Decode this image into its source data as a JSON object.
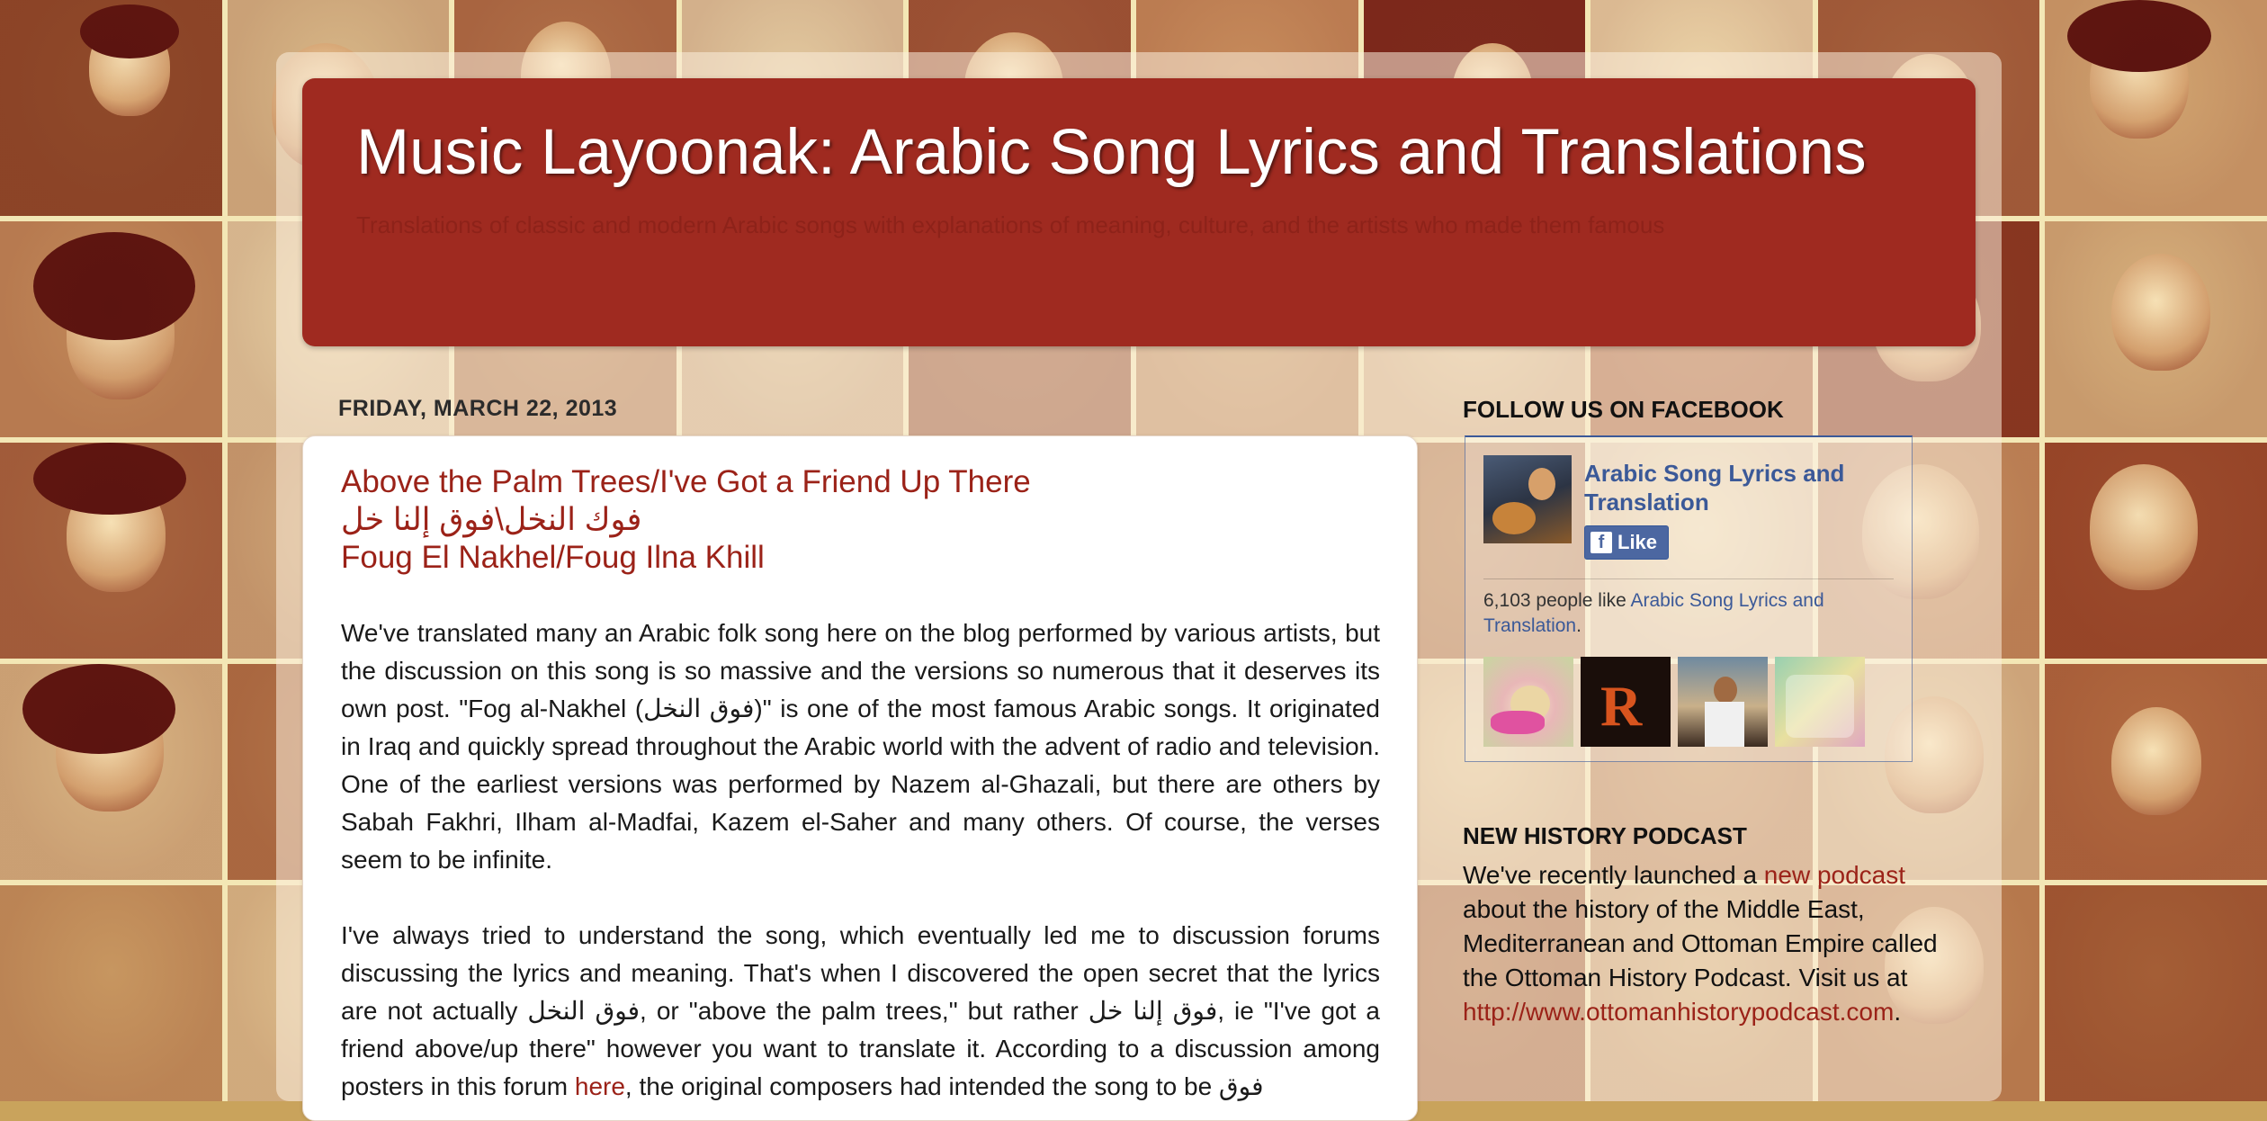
{
  "blog": {
    "title": "Music Layoonak: Arabic Song Lyrics and Translations",
    "description": "Translations of classic and modern Arabic songs with explanations of meaning, culture, and the artists who made them famous"
  },
  "post": {
    "date_header": "FRIDAY, MARCH 22, 2013",
    "title_line1": "Above the Palm Trees/I've Got a Friend Up There",
    "title_line2": "فوك النخل\\فوق إلنا خل",
    "title_line3": "Foug El Nakhel/Foug Ilna Khill",
    "p1": "We've translated many an Arabic folk song here on the blog performed by various artists, but the discussion on this song is so massive and the versions so numerous that it deserves its own post. \"Fog al-Nakhel (فوق النخل)\" is one of the most famous Arabic songs. It originated in Iraq and quickly spread throughout the Arabic world with the advent of radio and television. One of the earliest versions was performed by Nazem al-Ghazali, but there are others by Sabah Fakhri, Ilham al-Madfai, Kazem el-Saher and many others. Of course, the verses seem to be infinite.",
    "p2_before_link": "I've always tried to understand the song, which eventually led me to discussion forums discussing the lyrics and meaning. That's when I discovered the open secret that the lyrics are not actually فوق النخل, or \"above the palm trees,\" but rather فوق إلنا خل, ie \"I've got a friend above/up there\" however you want to translate it. According to a discussion among posters in this forum ",
    "p2_link": "here",
    "p2_after_link": ", the original composers had intended the song to be فوق"
  },
  "sidebar": {
    "facebook": {
      "heading": "FOLLOW US ON FACEBOOK",
      "page_name": "Arabic Song Lyrics and Translation",
      "like_label": "Like",
      "like_icon": "f",
      "count_prefix": "6,103 people like ",
      "count_link": "Arabic Song Lyrics and Translation",
      "count_suffix": "."
    },
    "podcast": {
      "heading": "NEW HISTORY PODCAST",
      "text_before_link": "We've recently launched a ",
      "link": "new podcast",
      "text_after_link": " about the history of the Middle East, Mediterranean and Ottoman Empire called the Ottoman History Podcast. Visit us at ",
      "url": "http://www.ottomanhistorypodcast.com",
      "url_suffix": "."
    }
  },
  "colors": {
    "header_bg": "#9f2a20",
    "title_link": "#9b2218",
    "fb_blue": "#3b5998"
  }
}
